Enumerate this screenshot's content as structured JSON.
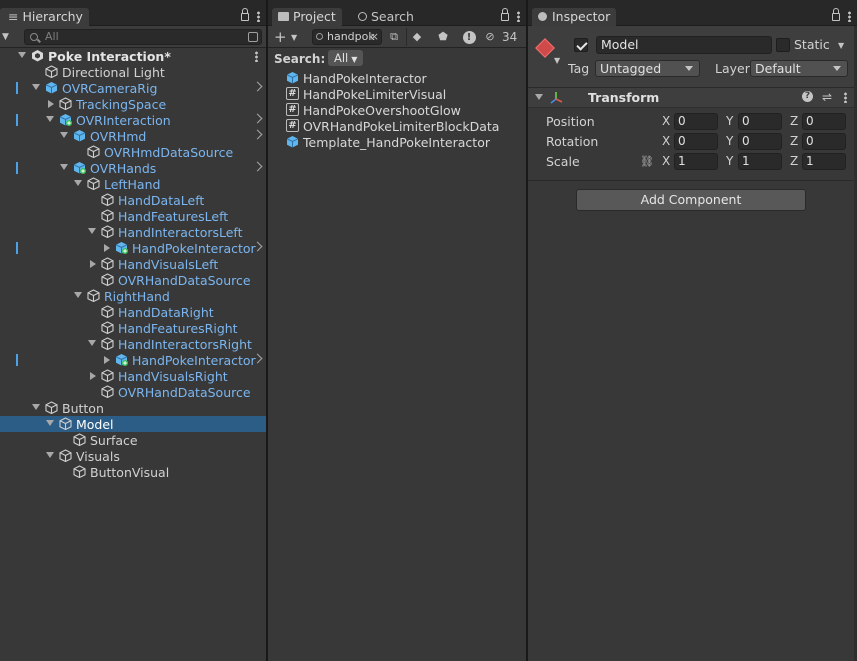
{
  "hierarchy": {
    "tab": "Hierarchy",
    "search_placeholder": "All",
    "rows": [
      {
        "label": "Poke Interaction*",
        "depth": 0,
        "expand": "down",
        "kind": "scene",
        "style": "bold",
        "kebab": true
      },
      {
        "label": "Directional Light",
        "depth": 1,
        "expand": "none",
        "kind": "cube"
      },
      {
        "label": "OVRCameraRig",
        "depth": 1,
        "expand": "down",
        "kind": "prefab",
        "style": "blue",
        "chevron": true,
        "bar": true
      },
      {
        "label": "TrackingSpace",
        "depth": 2,
        "expand": "right",
        "kind": "cube",
        "style": "blue"
      },
      {
        "label": "OVRInteraction",
        "depth": 2,
        "expand": "down",
        "kind": "prefab-plus",
        "style": "blue",
        "chevron": true,
        "bar": true
      },
      {
        "label": "OVRHmd",
        "depth": 3,
        "expand": "down",
        "kind": "prefab",
        "style": "blue",
        "chevron": true
      },
      {
        "label": "OVRHmdDataSource",
        "depth": 4,
        "expand": "none",
        "kind": "cube",
        "style": "blue"
      },
      {
        "label": "OVRHands",
        "depth": 3,
        "expand": "down",
        "kind": "prefab-plus",
        "style": "blue",
        "chevron": true,
        "bar": true
      },
      {
        "label": "LeftHand",
        "depth": 4,
        "expand": "down",
        "kind": "cube",
        "style": "blue"
      },
      {
        "label": "HandDataLeft",
        "depth": 5,
        "expand": "none",
        "kind": "cube",
        "style": "blue"
      },
      {
        "label": "HandFeaturesLeft",
        "depth": 5,
        "expand": "none",
        "kind": "cube",
        "style": "blue"
      },
      {
        "label": "HandInteractorsLeft",
        "depth": 5,
        "expand": "down",
        "kind": "cube",
        "style": "blue"
      },
      {
        "label": "HandPokeInteractor",
        "depth": 6,
        "expand": "right",
        "kind": "prefab-plus",
        "style": "blue",
        "chevron": true,
        "bar": true
      },
      {
        "label": "HandVisualsLeft",
        "depth": 5,
        "expand": "right",
        "kind": "cube",
        "style": "blue"
      },
      {
        "label": "OVRHandDataSource",
        "depth": 5,
        "expand": "none",
        "kind": "cube",
        "style": "blue"
      },
      {
        "label": "RightHand",
        "depth": 4,
        "expand": "down",
        "kind": "cube",
        "style": "blue"
      },
      {
        "label": "HandDataRight",
        "depth": 5,
        "expand": "none",
        "kind": "cube",
        "style": "blue"
      },
      {
        "label": "HandFeaturesRight",
        "depth": 5,
        "expand": "none",
        "kind": "cube",
        "style": "blue"
      },
      {
        "label": "HandInteractorsRight",
        "depth": 5,
        "expand": "down",
        "kind": "cube",
        "style": "blue"
      },
      {
        "label": "HandPokeInteractor",
        "depth": 6,
        "expand": "right",
        "kind": "prefab-plus",
        "style": "blue",
        "chevron": true,
        "bar": true
      },
      {
        "label": "HandVisualsRight",
        "depth": 5,
        "expand": "right",
        "kind": "cube",
        "style": "blue"
      },
      {
        "label": "OVRHandDataSource",
        "depth": 5,
        "expand": "none",
        "kind": "cube",
        "style": "blue"
      },
      {
        "label": "Button",
        "depth": 1,
        "expand": "down",
        "kind": "cube"
      },
      {
        "label": "Model",
        "depth": 2,
        "expand": "down",
        "kind": "cube",
        "selected": true
      },
      {
        "label": "Surface",
        "depth": 3,
        "expand": "none",
        "kind": "cube"
      },
      {
        "label": "Visuals",
        "depth": 2,
        "expand": "down",
        "kind": "cube"
      },
      {
        "label": "ButtonVisual",
        "depth": 3,
        "expand": "none",
        "kind": "cube"
      }
    ]
  },
  "project": {
    "tab_project": "Project",
    "tab_search": "Search",
    "search_value": "handpok",
    "count": "34",
    "search_label": "Search:",
    "filter": "All",
    "results": [
      {
        "label": "HandPokeInteractor",
        "kind": "prefab"
      },
      {
        "label": "HandPokeLimiterVisual",
        "kind": "script"
      },
      {
        "label": "HandPokeOvershootGlow",
        "kind": "script"
      },
      {
        "label": "OVRHandPokeLimiterBlockData",
        "kind": "script"
      },
      {
        "label": "Template_HandPokeInteractor",
        "kind": "prefab"
      }
    ]
  },
  "inspector": {
    "tab": "Inspector",
    "object_name": "Model",
    "static_label": "Static",
    "tag_label": "Tag",
    "tag_value": "Untagged",
    "layer_label": "Layer",
    "layer_value": "Default",
    "transform": {
      "title": "Transform",
      "position": {
        "label": "Position",
        "x": "0",
        "y": "0",
        "z": "0"
      },
      "rotation": {
        "label": "Rotation",
        "x": "0",
        "y": "0",
        "z": "0"
      },
      "scale": {
        "label": "Scale",
        "x": "1",
        "y": "1",
        "z": "1"
      }
    },
    "add_component": "Add Component"
  },
  "colors": {
    "selection": "#2c5d87",
    "prefab_text": "#7bb6f0",
    "panel": "#383838"
  }
}
